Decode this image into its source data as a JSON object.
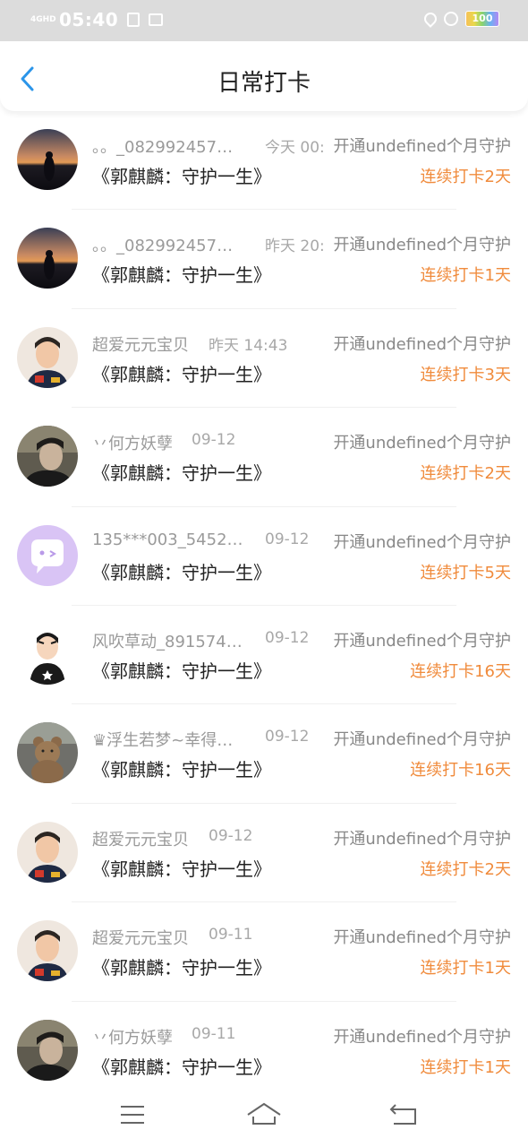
{
  "status_bar": {
    "network": "4GHD",
    "time": "05:40",
    "battery": "100",
    "battery_level": 1.0,
    "icons": [
      "signal-icon",
      "clipboard-icon",
      "image-icon",
      "location-icon",
      "alarm-icon",
      "battery-icon"
    ]
  },
  "header": {
    "title": "日常打卡",
    "back_icon": "chevron-left-icon",
    "accent": "#2b95e9"
  },
  "list": {
    "items": [
      {
        "name": "。。_082992457…",
        "time": "今天 00:",
        "open_text": "开通undefined个月守护",
        "song": "《郭麒麟：守护一生》",
        "streak": "连续打卡2天",
        "avatar": "sunset"
      },
      {
        "name": "。。_082992457…",
        "time": "昨天 20:",
        "open_text": "开通undefined个月守护",
        "song": "《郭麒麟：守护一生》",
        "streak": "连续打卡1天",
        "avatar": "sunset"
      },
      {
        "name": "超爱元元宝贝",
        "time": "昨天 14:43",
        "open_text": "开通undefined个月守护",
        "song": "《郭麒麟：守护一生》",
        "streak": "连续打卡3天",
        "avatar": "man"
      },
      {
        "name": "丷何方妖孽",
        "time": "09-12",
        "open_text": "开通undefined个月守护",
        "song": "《郭麒麟：守护一生》",
        "streak": "连续打卡2天",
        "avatar": "dark"
      },
      {
        "name": "135***003_5452…",
        "time": "09-12",
        "open_text": "开通undefined个月守护",
        "song": "《郭麒麟：守护一生》",
        "streak": "连续打卡5天",
        "avatar": "chat"
      },
      {
        "name": "风吹草动_891574…",
        "time": "09-12",
        "open_text": "开通undefined个月守护",
        "song": "《郭麒麟：守护一生》",
        "streak": "连续打卡16天",
        "avatar": "cartoon"
      },
      {
        "name": "♛浮生若梦~幸得…",
        "time": "09-12",
        "open_text": "开通undefined个月守护",
        "song": "《郭麒麟：守护一生》",
        "streak": "连续打卡16天",
        "avatar": "bear"
      },
      {
        "name": "超爱元元宝贝",
        "time": "09-12",
        "open_text": "开通undefined个月守护",
        "song": "《郭麒麟：守护一生》",
        "streak": "连续打卡2天",
        "avatar": "man"
      },
      {
        "name": "超爱元元宝贝",
        "time": "09-11",
        "open_text": "开通undefined个月守护",
        "song": "《郭麒麟：守护一生》",
        "streak": "连续打卡1天",
        "avatar": "man"
      },
      {
        "name": "丷何方妖孽",
        "time": "09-11",
        "open_text": "开通undefined个月守护",
        "song": "《郭麒麟：守护一生》",
        "streak": "连续打卡1天",
        "avatar": "dark"
      }
    ]
  },
  "nav_bar": {
    "icons": [
      "menu-icon",
      "home-icon",
      "back-icon"
    ]
  },
  "colors": {
    "streak": "#f08b3c",
    "name": "#9a9a9a",
    "song": "#222222",
    "status_bar_bg": "#dcdcdc"
  }
}
